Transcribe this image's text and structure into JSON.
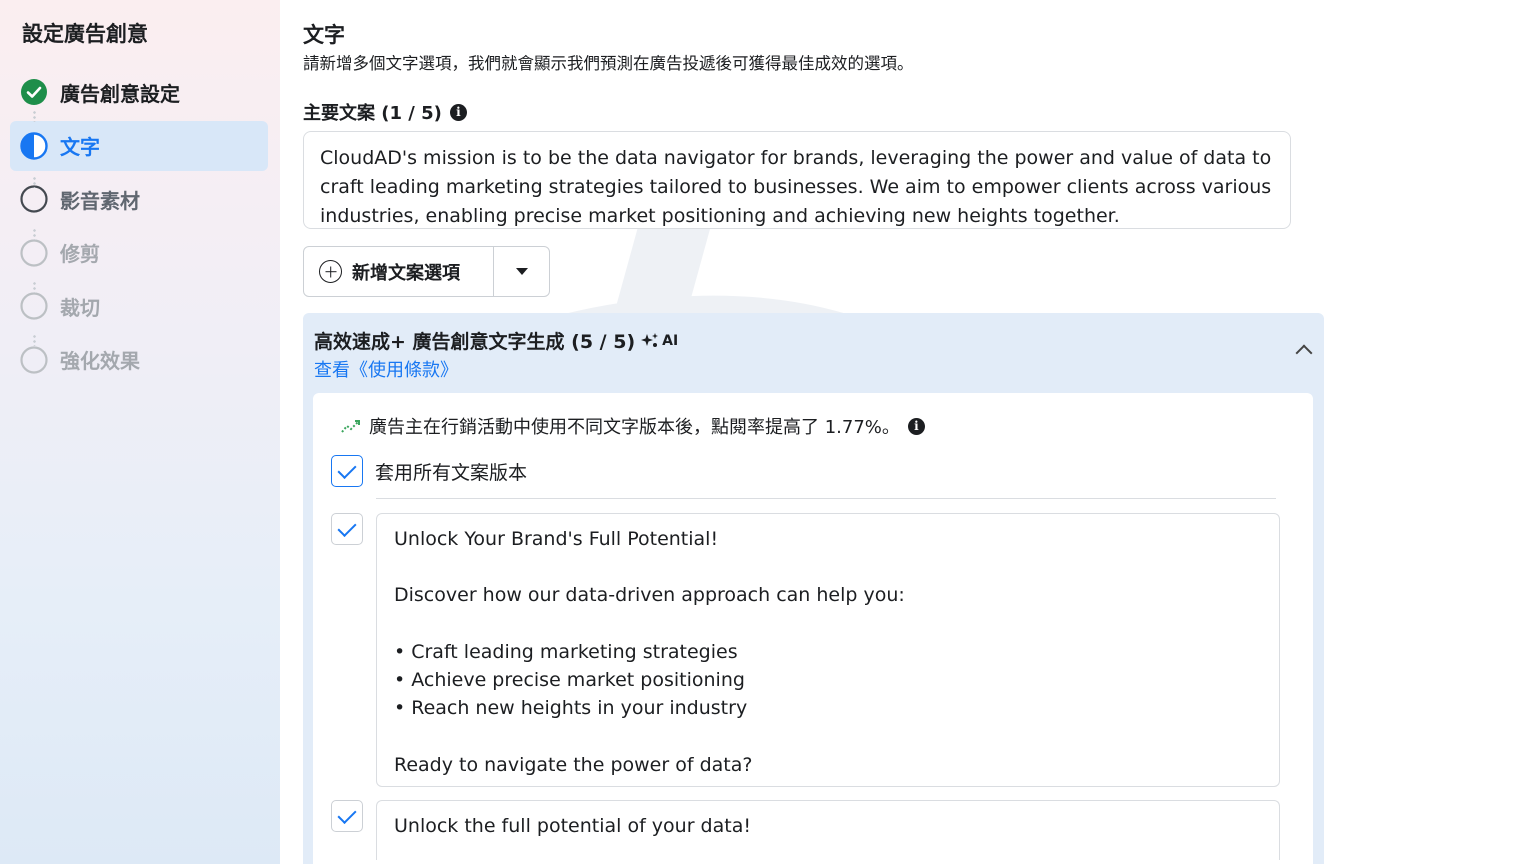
{
  "sidebar": {
    "title": "設定廣告創意",
    "steps": [
      {
        "label": "廣告創意設定",
        "state": "done"
      },
      {
        "label": "文字",
        "state": "active"
      },
      {
        "label": "影音素材",
        "state": "normal"
      },
      {
        "label": "修剪",
        "state": "muted"
      },
      {
        "label": "裁切",
        "state": "muted"
      },
      {
        "label": "強化效果",
        "state": "muted"
      }
    ]
  },
  "main": {
    "title": "文字",
    "subtitle": "請新增多個文字選項，我們就會顯示我們預測在廣告投遞後可獲得最佳成效的選項。",
    "primary_text_label": "主要文案 (1 / 5)",
    "primary_text_value": "CloudAD's mission is to be the data navigator for brands, leveraging the power and value of data to craft leading marketing strategies tailored to businesses. We aim to empower clients across various industries, enabling precise market positioning and achieving new heights together.",
    "add_text_button": "新增文案選項"
  },
  "ai_panel": {
    "title": "高效速成+ 廣告創意文字生成 (5 / 5)",
    "ai_badge": "AI",
    "terms_link": "查看《使用條款》",
    "stat_text": "廣告主在行銷活動中使用不同文字版本後，點閱率提高了 1.77%。",
    "apply_all_label": "套用所有文案版本",
    "variant1": {
      "line1": "Unlock Your Brand's Full Potential!",
      "line2": "Discover how our data-driven approach can help you:",
      "bullet1": "Craft leading marketing strategies",
      "bullet2": "Achieve precise market positioning",
      "bullet3": "Reach new heights in your industry",
      "line3": "Ready to navigate the power of data?"
    },
    "variant2": {
      "line1": "Unlock the full potential of your data!"
    }
  },
  "colors": {
    "accent": "#1877f2",
    "done": "#1e8e4a",
    "panel_bg": "#e2ecf8"
  }
}
